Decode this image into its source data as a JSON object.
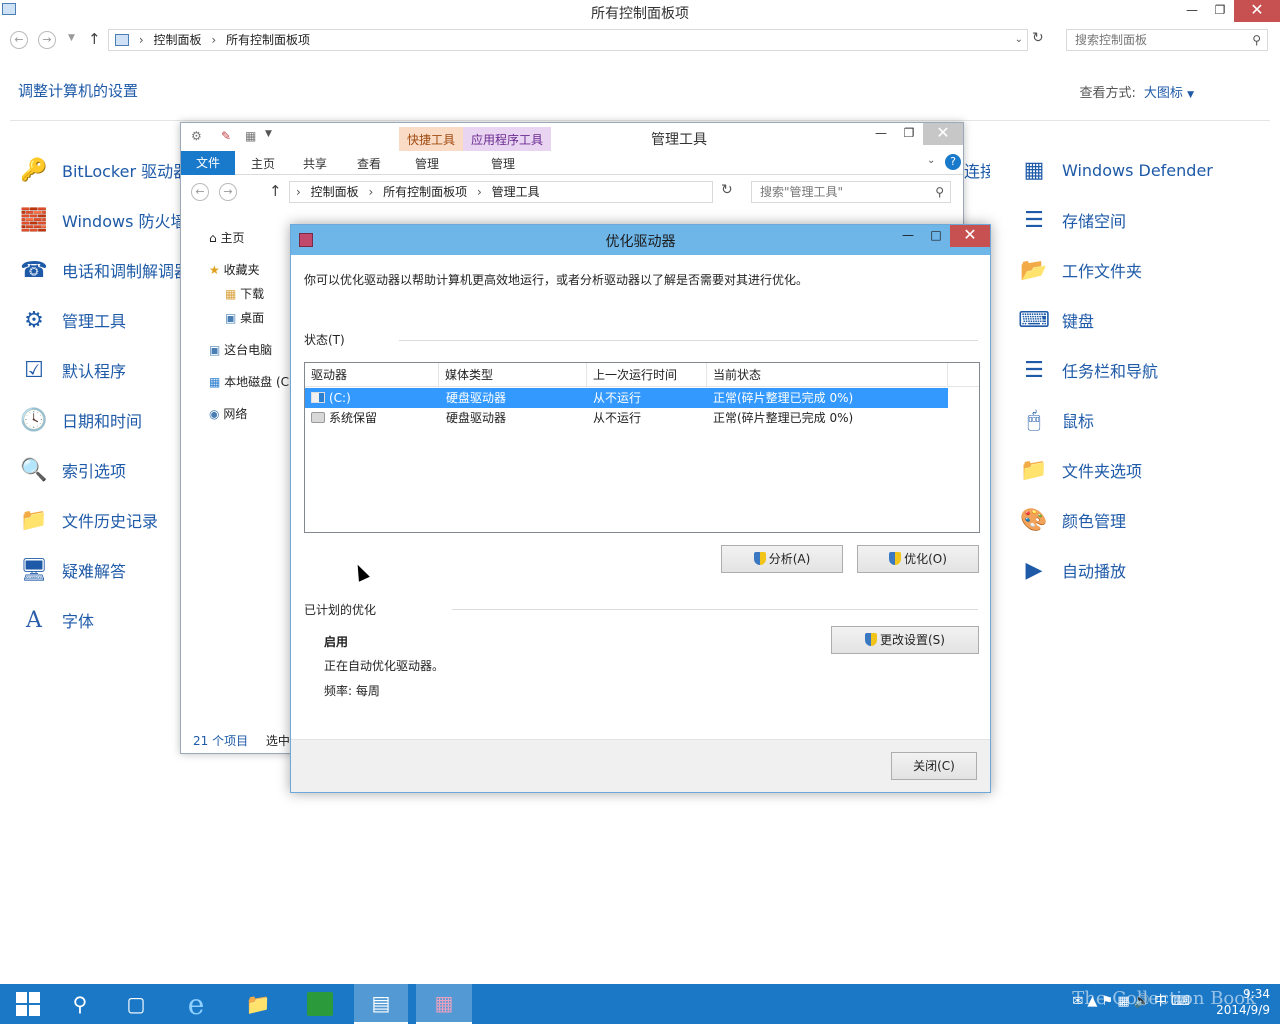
{
  "control_panel": {
    "title": "所有控制面板项",
    "breadcrumb": [
      "控制面板",
      "所有控制面板项"
    ],
    "search_placeholder": "搜索控制面板",
    "heading": "调整计算机的设置",
    "view_by_label": "查看方式:",
    "view_by_value": "大图标",
    "left_items": [
      {
        "label": "BitLocker 驱动器",
        "icon": "bitlocker-icon"
      },
      {
        "label": "Windows 防火墙",
        "icon": "firewall-icon"
      },
      {
        "label": "电话和调制解调器",
        "icon": "phone-modem-icon"
      },
      {
        "label": "管理工具",
        "icon": "admin-tools-icon"
      },
      {
        "label": "默认程序",
        "icon": "default-programs-icon"
      },
      {
        "label": "日期和时间",
        "icon": "date-time-icon"
      },
      {
        "label": "索引选项",
        "icon": "indexing-icon"
      },
      {
        "label": "文件历史记录",
        "icon": "file-history-icon"
      },
      {
        "label": "疑难解答",
        "icon": "troubleshoot-icon"
      },
      {
        "label": "字体",
        "icon": "fonts-icon"
      }
    ],
    "right_items": [
      {
        "label": "Windows Defender",
        "icon": "defender-icon"
      },
      {
        "label": "存储空间",
        "icon": "storage-spaces-icon"
      },
      {
        "label": "工作文件夹",
        "icon": "work-folders-icon"
      },
      {
        "label": "键盘",
        "icon": "keyboard-icon"
      },
      {
        "label": "任务栏和导航",
        "icon": "taskbar-nav-icon"
      },
      {
        "label": "鼠标",
        "icon": "mouse-icon"
      },
      {
        "label": "文件夹选项",
        "icon": "folder-options-icon"
      },
      {
        "label": "颜色管理",
        "icon": "color-management-icon"
      },
      {
        "label": "自动播放",
        "icon": "autoplay-icon"
      }
    ],
    "partial_item": "连接"
  },
  "admin_tools": {
    "title": "管理工具",
    "context_tab_1": "快捷工具",
    "context_tab_2": "应用程序工具",
    "ribbon_tabs": [
      "文件",
      "主页",
      "共享",
      "查看",
      "管理",
      "管理"
    ],
    "breadcrumb": [
      "控制面板",
      "所有控制面板项",
      "管理工具"
    ],
    "search_placeholder": "搜索\"管理工具\"",
    "nav": [
      "主页",
      "收藏夹",
      "下载",
      "桌面",
      "这台电脑",
      "本地磁盘 (C",
      "网络"
    ],
    "status_count": "21 个项目",
    "status_selected": "选中"
  },
  "dialog": {
    "title": "优化驱动器",
    "description": "你可以优化驱动器以帮助计算机更高效地运行，或者分析驱动器以了解是否需要对其进行优化。",
    "status_group": "状态(T)",
    "columns": [
      "驱动器",
      "媒体类型",
      "上一次运行时间",
      "当前状态"
    ],
    "rows": [
      {
        "drive": "(C:)",
        "media": "硬盘驱动器",
        "last_run": "从不运行",
        "status": "正常(碎片整理已完成 0%)"
      },
      {
        "drive": "系统保留",
        "media": "硬盘驱动器",
        "last_run": "从不运行",
        "status": "正常(碎片整理已完成 0%)"
      }
    ],
    "analyze_button": "分析(A)",
    "optimize_button": "优化(O)",
    "scheduled_group": "已计划的优化",
    "schedule_state": "启用",
    "schedule_desc": "正在自动优化驱动器。",
    "frequency": "频率: 每周",
    "change_settings_button": "更改设置(S)",
    "close_button": "关闭(C)"
  },
  "taskbar": {
    "time": "9:34",
    "date": "2014/9/9",
    "ime": "中",
    "watermark": "The Collection Book"
  }
}
